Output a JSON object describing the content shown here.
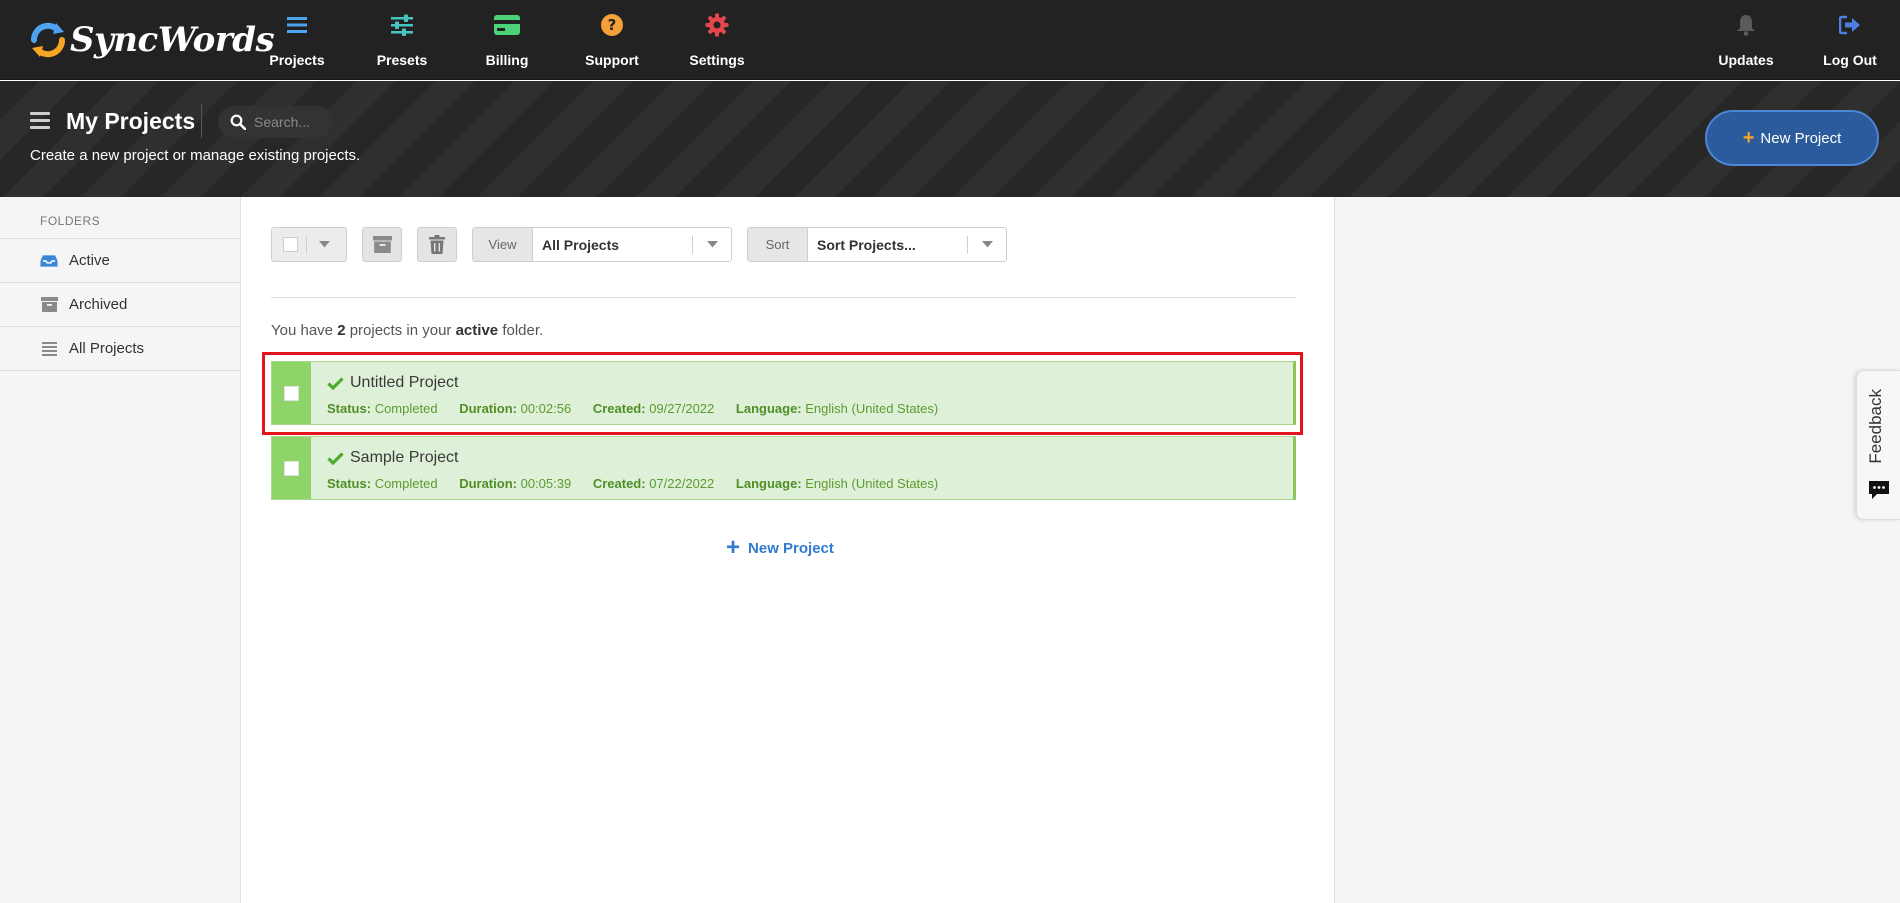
{
  "app": {
    "brand": "SyncWords"
  },
  "nav": {
    "items": [
      {
        "label": "Projects",
        "icon": "list-icon",
        "color": "#4ea3f1"
      },
      {
        "label": "Presets",
        "icon": "sliders-icon",
        "color": "#45c4c0"
      },
      {
        "label": "Billing",
        "icon": "credit-card-icon",
        "color": "#4cd37a"
      },
      {
        "label": "Support",
        "icon": "question-icon",
        "color": "#f5a038"
      },
      {
        "label": "Settings",
        "icon": "gear-icon",
        "color": "#e5474d"
      }
    ],
    "right": [
      {
        "label": "Updates",
        "icon": "bell-icon"
      },
      {
        "label": "Log Out",
        "icon": "sign-out-icon"
      }
    ]
  },
  "header": {
    "title": "My Projects",
    "search_placeholder": "Search...",
    "subtitle": "Create a new project or manage existing projects.",
    "new_project_label": "New Project"
  },
  "sidebar": {
    "heading": "FOLDERS",
    "items": [
      {
        "label": "Active",
        "icon": "inbox-icon"
      },
      {
        "label": "Archived",
        "icon": "archive-icon"
      },
      {
        "label": "All Projects",
        "icon": "list-icon"
      }
    ]
  },
  "toolbar": {
    "view_label": "View",
    "view_value": "All Projects",
    "sort_label": "Sort",
    "sort_value": "Sort Projects..."
  },
  "summary": {
    "prefix": "You have",
    "count": "2",
    "middle": "projects in your",
    "folder": "active",
    "suffix": "folder."
  },
  "projects": [
    {
      "name": "Untitled Project",
      "status_key": "Status:",
      "status": "Completed",
      "duration_key": "Duration:",
      "duration": "00:02:56",
      "created_key": "Created:",
      "created": "09/27/2022",
      "language_key": "Language:",
      "language": "English (United States)"
    },
    {
      "name": "Sample Project",
      "status_key": "Status:",
      "status": "Completed",
      "duration_key": "Duration:",
      "duration": "00:05:39",
      "created_key": "Created:",
      "created": "07/22/2022",
      "language_key": "Language:",
      "language": "English (United States)"
    }
  ],
  "new_project_link": "New Project",
  "feedback_label": "Feedback",
  "colors": {
    "accent_blue": "#2f7bd0",
    "success_green": "#8fd468",
    "highlight_red": "#e3141b",
    "nav_bg": "#222222"
  }
}
